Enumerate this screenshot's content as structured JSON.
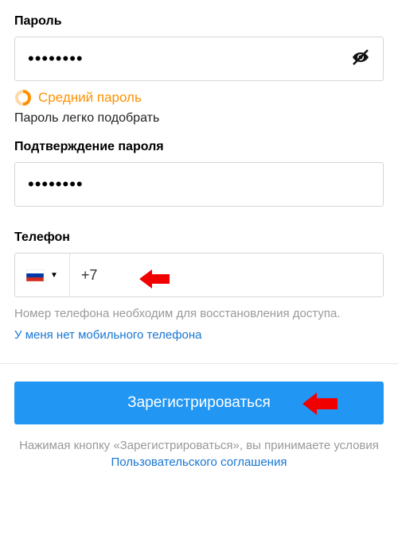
{
  "password": {
    "label": "Пароль",
    "value": "••••••••",
    "strength_text": "Средний пароль",
    "hint": "Пароль легко подобрать"
  },
  "confirm": {
    "label": "Подтверждение пароля",
    "value": "••••••••"
  },
  "phone": {
    "label": "Телефон",
    "prefix": "+7",
    "help": "Номер телефона необходим для восстановления доступа.",
    "no_phone_link": "У меня нет мобильного телефона"
  },
  "submit": {
    "label": "Зарегистрироваться"
  },
  "footer": {
    "text_before": "Нажимая кнопку «Зарегистрироваться», вы принимаете условия ",
    "link": "Пользовательского соглашения"
  }
}
